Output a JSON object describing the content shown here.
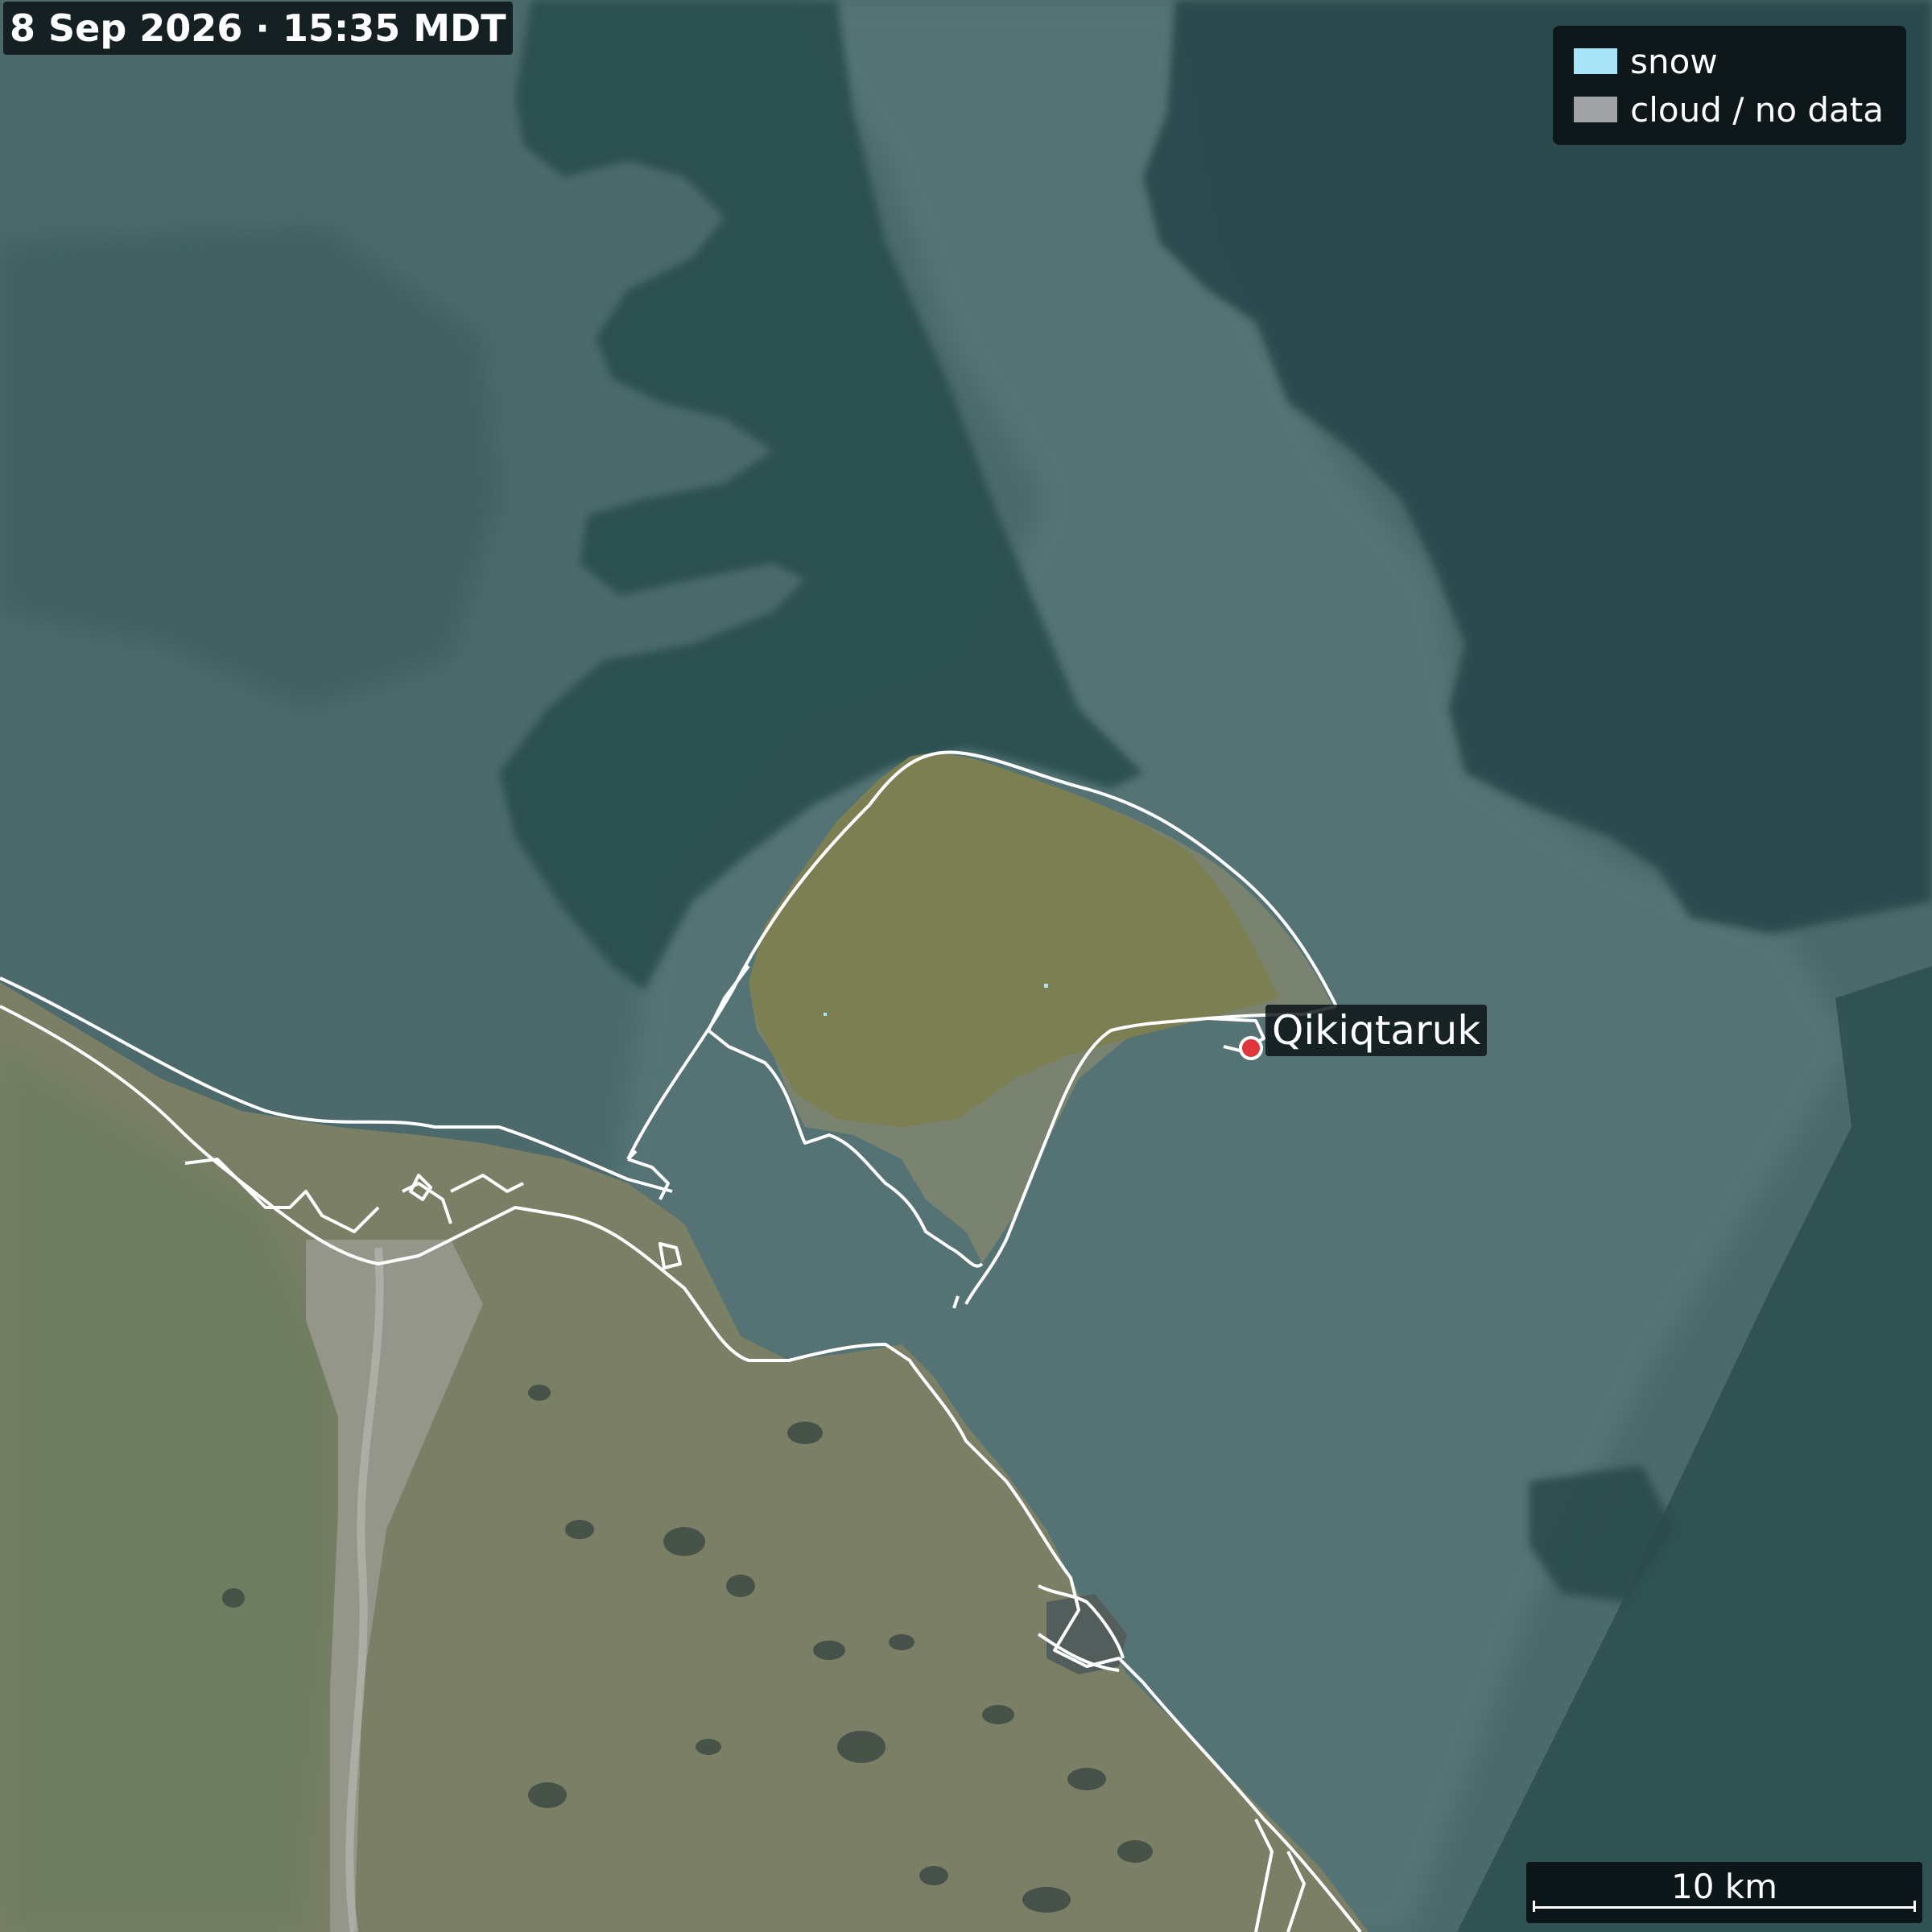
{
  "header": {
    "timestamp": "8 Sep 2026 · 15:35 MDT"
  },
  "legend": {
    "items": [
      {
        "label": "snow",
        "color": "#a8e4f8"
      },
      {
        "label": "cloud / no data",
        "color": "#a0a2a4"
      }
    ]
  },
  "place": {
    "name": "Qikiqtaruk",
    "marker_color": "#e0353a"
  },
  "scalebar": {
    "label": "10 km"
  },
  "colors": {
    "sea": "#4a6a6c",
    "dark_water": "#2d5152",
    "land": "#7c8266",
    "island": "#7a8050",
    "coastline": "#ffffff"
  }
}
